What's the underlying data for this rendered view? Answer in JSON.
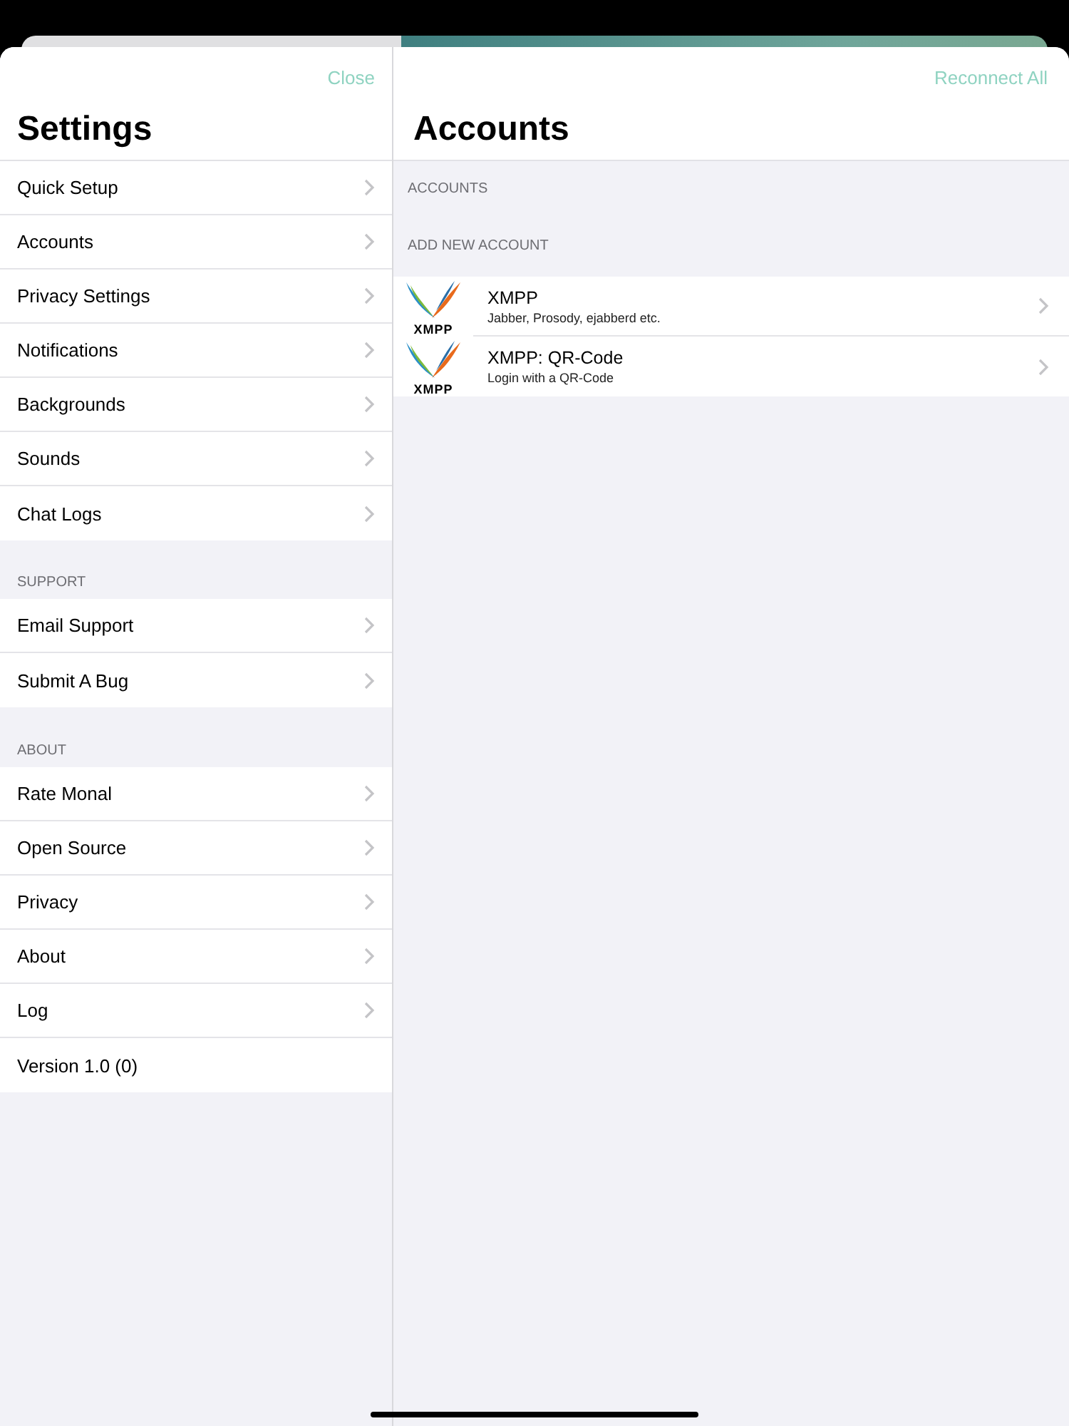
{
  "sidebar": {
    "close": "Close",
    "title": "Settings",
    "sections": [
      {
        "items": [
          {
            "label": "Quick Setup",
            "kind": "link"
          },
          {
            "label": "Accounts",
            "kind": "link"
          },
          {
            "label": "Privacy Settings",
            "kind": "link"
          },
          {
            "label": "Notifications",
            "kind": "link"
          },
          {
            "label": "Backgrounds",
            "kind": "link"
          },
          {
            "label": "Sounds",
            "kind": "link"
          },
          {
            "label": "Chat Logs",
            "kind": "link"
          }
        ]
      },
      {
        "header": "SUPPORT",
        "items": [
          {
            "label": "Email Support",
            "kind": "link"
          },
          {
            "label": "Submit A Bug",
            "kind": "link"
          }
        ]
      },
      {
        "header": "ABOUT",
        "items": [
          {
            "label": "Rate Monal",
            "kind": "link"
          },
          {
            "label": "Open Source",
            "kind": "link"
          },
          {
            "label": "Privacy",
            "kind": "link"
          },
          {
            "label": "About",
            "kind": "link"
          },
          {
            "label": "Log",
            "kind": "link"
          },
          {
            "label": "Version 1.0 (0)",
            "kind": "info"
          }
        ]
      }
    ]
  },
  "detail": {
    "action": "Reconnect All",
    "title": "Accounts",
    "accounts_header": "ACCOUNTS",
    "add_header": "ADD NEW ACCOUNT",
    "options": [
      {
        "title": "XMPP",
        "subtitle": "Jabber, Prosody, ejabberd etc.",
        "logo_text": "XMPP"
      },
      {
        "title": "XMPP: QR-Code",
        "subtitle": "Login with a QR-Code",
        "logo_text": "XMPP"
      }
    ]
  }
}
